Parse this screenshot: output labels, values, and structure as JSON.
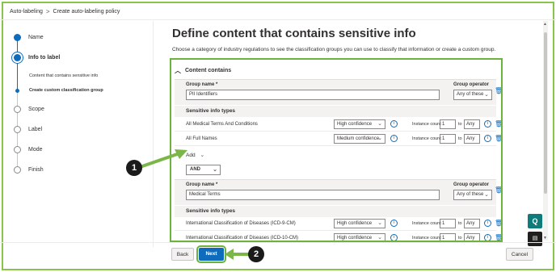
{
  "breadcrumb": {
    "root": "Auto-labeling",
    "separator": ">",
    "current": "Create auto-labeling policy"
  },
  "stepper": {
    "steps": [
      {
        "label": "Name"
      },
      {
        "label": "Info to label"
      },
      {
        "label": "Scope"
      },
      {
        "label": "Label"
      },
      {
        "label": "Mode"
      },
      {
        "label": "Finish"
      }
    ],
    "substeps": [
      {
        "label": "Content that contains sensitive info"
      },
      {
        "label": "Create custom classification group"
      }
    ]
  },
  "main": {
    "title": "Define content that contains sensitive info",
    "description": "Choose a category of industry regulations to see the classification groups you can use to classify that information or create a custom group."
  },
  "panel": {
    "header": "Content contains",
    "group_name_label": "Group name *",
    "group_operator_label": "Group operator",
    "sit_title": "Sensitive info types",
    "instance_count_label": "Instance count",
    "to_label": "to",
    "add_label": "Add",
    "and_label": "AND",
    "groups": [
      {
        "name": "PII Identifiers",
        "operator": "Any of these",
        "items": [
          {
            "name": "All Medical Terms And Conditions",
            "confidence": "High confidence",
            "min": "1",
            "max": "Any"
          },
          {
            "name": "All Full Names",
            "confidence": "Medium confidence",
            "min": "1",
            "max": "Any"
          }
        ]
      },
      {
        "name": "Medical Terms",
        "operator": "Any of these",
        "items": [
          {
            "name": "International Classification of Diseases (ICD-9-CM)",
            "confidence": "High confidence",
            "min": "1",
            "max": "Any"
          },
          {
            "name": "International Classification of Diseases (ICD-10-CM)",
            "confidence": "High confidence",
            "min": "1",
            "max": "Any"
          }
        ]
      }
    ]
  },
  "footer": {
    "back": "Back",
    "next": "Next",
    "cancel": "Cancel"
  },
  "callouts": {
    "one": "1",
    "two": "2"
  },
  "side_buttons": {
    "top": "Q",
    "bottom": "▤"
  },
  "colors": {
    "accent": "#0f6cbd",
    "highlight": "#6bb33c",
    "frame": "#8ac349"
  }
}
